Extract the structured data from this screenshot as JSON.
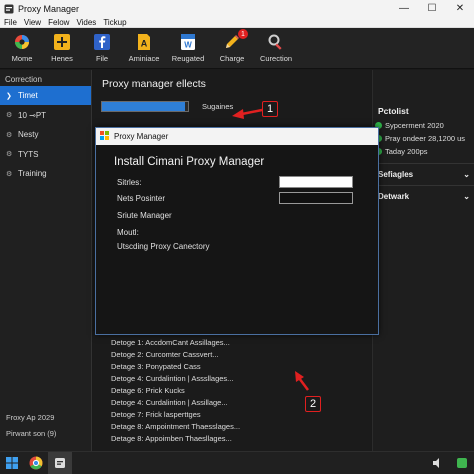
{
  "window": {
    "title": "Proxy Manager",
    "controls": {
      "minimize": "—",
      "maximize": "☐",
      "close": "✕"
    }
  },
  "menu": [
    "File",
    "View",
    "Felow",
    "Vides",
    "Tickup"
  ],
  "toolbar": [
    {
      "label": "Mome",
      "icon": "gear-multicolor-icon"
    },
    {
      "label": "Henes",
      "icon": "plus-icon"
    },
    {
      "label": "File",
      "icon": "facebook-icon"
    },
    {
      "label": "Aminiace",
      "icon": "document-a-icon"
    },
    {
      "label": "Reugated",
      "icon": "word-icon"
    },
    {
      "label": "Charge",
      "icon": "pencil-icon",
      "badge": "1"
    },
    {
      "label": "Curection",
      "icon": "magnifier-icon"
    }
  ],
  "sidebar": {
    "heading": "Correction",
    "items": [
      {
        "label": "Timet",
        "icon": "chevron-right-icon",
        "active": true
      },
      {
        "label": "10 ⊸PT",
        "icon": "gear-icon",
        "active": false
      },
      {
        "label": "Nesty",
        "icon": "gear-icon",
        "active": false
      },
      {
        "label": "TYTS",
        "icon": "gear-icon",
        "active": false
      },
      {
        "label": "Training",
        "icon": "gear-icon",
        "active": false
      }
    ],
    "footer": [
      "Froxy Ap 2029",
      "Pirwant son (9)"
    ]
  },
  "main": {
    "title": "Proxy manager ellects",
    "progress": {
      "value_percent": 97,
      "label": "Sugaines"
    },
    "log": [
      "Detoge 1:  AccdomCant Assillages...",
      "Detoge 2:  Curcomter Cassvert...",
      "Detage 3:  Ponypated Cass",
      "Detoge 4:  Curdalintion | Asssllages...",
      "Detage 6:  Prick Kucks",
      "Detoge 4:  Curdalintion | Assillage...",
      "Detoge 7:  Frick lasperttges",
      "Detage 8:  Ampointment Thaesslages...",
      "Detage 8:  Appoimben Thaesllages..."
    ]
  },
  "dialog": {
    "title": "Proxy Manager",
    "heading": "Install Cimani Proxy Manager",
    "fields": [
      "Sitrles:",
      "Nets Posinter",
      "Sriute Manager",
      "Moutl:",
      "Utscding Proxy Canectory"
    ]
  },
  "right_pane": {
    "title": "Pctolist",
    "rows": [
      "Sypcerment 2020",
      "Pray ondeer 28,1200 us",
      "Taday 200ps"
    ],
    "sections": [
      "Sefiagles",
      "Detwark"
    ]
  },
  "annotations": [
    "1",
    "2"
  ],
  "colors": {
    "accent": "#1e6fd0",
    "progress": "#2f7fd6",
    "annotation": "#e02020",
    "status_green": "#2fb34a",
    "background": "#1b1b1b"
  }
}
